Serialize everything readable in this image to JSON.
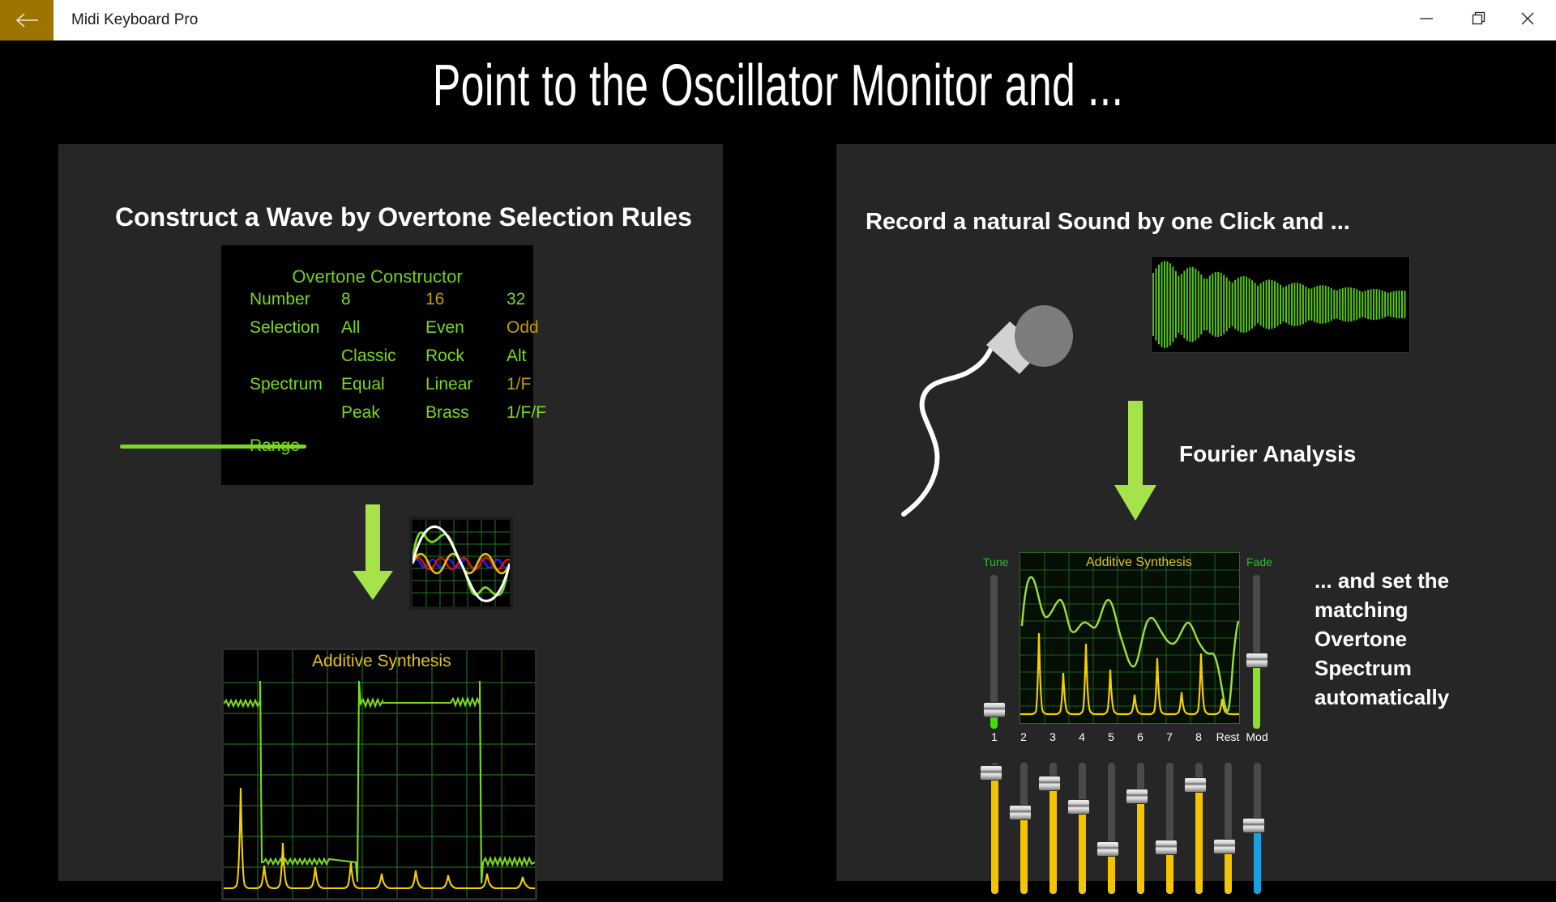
{
  "window": {
    "app_title": "Midi Keyboard Pro",
    "back_icon": "back-arrow-icon",
    "minimize_icon": "minimize-icon",
    "maximize_icon": "maximize-icon",
    "close_icon": "close-icon"
  },
  "slide": {
    "title": "Point to the Oscillator Monitor and ...",
    "left_panel_heading": "Construct a Wave by Overtone Selection Rules",
    "right_panel_heading": "Record a natural Sound by one Click and ...",
    "fourier_label": "Fourier Analysis",
    "right_note": "... and set the matching Overtone Spectrum automatically"
  },
  "overtone_constructor": {
    "title": "Overtone Constructor",
    "rows": [
      {
        "label": "Number",
        "options": [
          {
            "text": "8",
            "selected": false
          },
          {
            "text": "16",
            "selected": true
          },
          {
            "text": "32",
            "selected": false
          }
        ]
      },
      {
        "label": "Selection",
        "options": [
          {
            "text": "All",
            "selected": false
          },
          {
            "text": "Even",
            "selected": false
          },
          {
            "text": "Odd",
            "selected": true
          }
        ]
      },
      {
        "label": "",
        "options": [
          {
            "text": "Classic",
            "selected": false
          },
          {
            "text": "Rock",
            "selected": false
          },
          {
            "text": "Alt",
            "selected": false
          }
        ]
      },
      {
        "label": "Spectrum",
        "options": [
          {
            "text": "Equal",
            "selected": false
          },
          {
            "text": "Linear",
            "selected": false
          },
          {
            "text": "1/F",
            "selected": true
          }
        ]
      },
      {
        "label": "",
        "options": [
          {
            "text": "Peak",
            "selected": false
          },
          {
            "text": "Brass",
            "selected": false
          },
          {
            "text": "1/F/F",
            "selected": false
          }
        ]
      }
    ],
    "range": {
      "label": "Range",
      "value_percent": 44
    }
  },
  "left_additive_plot": {
    "title": "Additive Synthesis"
  },
  "oscillator_monitor": {
    "title": "Additive Synthesis",
    "tune": {
      "label": "Tune",
      "value_percent": 12
    },
    "fade": {
      "label": "Fade",
      "value_percent": 44
    },
    "channel_labels": [
      "1",
      "2",
      "3",
      "4",
      "5",
      "6",
      "7",
      "8",
      "Rest",
      "Mod"
    ],
    "faders": [
      {
        "name": "1",
        "value_percent": 92,
        "color": "#f5c400"
      },
      {
        "name": "2",
        "value_percent": 62,
        "color": "#f5c400"
      },
      {
        "name": "3",
        "value_percent": 84,
        "color": "#f5c400"
      },
      {
        "name": "4",
        "value_percent": 66,
        "color": "#f5c400"
      },
      {
        "name": "5",
        "value_percent": 34,
        "color": "#f5c400"
      },
      {
        "name": "6",
        "value_percent": 74,
        "color": "#f5c400"
      },
      {
        "name": "7",
        "value_percent": 35,
        "color": "#f5c400"
      },
      {
        "name": "8",
        "value_percent": 83,
        "color": "#f5c400"
      },
      {
        "name": "Rest",
        "value_percent": 36,
        "color": "#f5c400"
      },
      {
        "name": "Mod",
        "value_percent": 52,
        "color": "#1a9fe0"
      }
    ]
  },
  "colors": {
    "accent_gold": "#9e7400",
    "panel_bg": "#262626",
    "stage_bg": "#000000",
    "green": "#7ad91c",
    "selected_gold": "#c49c00",
    "arrow_green": "#a6e34a",
    "spectrum_yellow": "#f5d000",
    "mod_blue": "#1a9fe0"
  },
  "chart_data": [
    {
      "type": "line",
      "id": "recorded-waveform",
      "title": "",
      "description": "Decaying natural sound waveform captured from microphone",
      "series": [
        {
          "name": "amplitude",
          "envelope": "exponential-decay",
          "cycles": 72
        }
      ],
      "grid": false,
      "colors": [
        "#58c41a"
      ]
    },
    {
      "type": "line",
      "id": "mini-oscilloscope",
      "title": "",
      "description": "Overlaid harmonic partials and resulting composite wave",
      "series": [
        {
          "name": "composite",
          "color": "#ffffff",
          "harmonic": 1,
          "amplitude": 1.0
        },
        {
          "name": "partial-2",
          "color": "#7ad91c",
          "harmonic": 3,
          "amplitude": 0.95
        },
        {
          "name": "partial-3",
          "color": "#e8c000",
          "harmonic": 3,
          "amplitude": 0.45
        },
        {
          "name": "partial-4",
          "color": "#d81111",
          "harmonic": 5,
          "amplitude": 0.25
        },
        {
          "name": "partial-5",
          "color": "#2222ee",
          "harmonic": 7,
          "amplitude": 0.18
        }
      ],
      "grid": true
    },
    {
      "type": "line",
      "id": "left-additive-synthesis",
      "title": "Additive Synthesis",
      "description": "Square-wave time signal (green) with its odd-harmonic spectrum (yellow)",
      "series": [
        {
          "name": "waveform",
          "color": "#7ad91c",
          "shape": "square",
          "duty": 0.5
        },
        {
          "name": "spectrum",
          "color": "#f5d000",
          "peaks": [
            0.52,
            0.1,
            0.22,
            0.06,
            0.13,
            0.05,
            0.08,
            0.04,
            0.06,
            0.03
          ]
        }
      ],
      "grid": true,
      "gridcolor": "#1d6b1d"
    },
    {
      "type": "line",
      "id": "right-additive-synthesis",
      "title": "Additive Synthesis",
      "description": "Composite waveform (green) over partial spectrum peaks (yellow)",
      "series": [
        {
          "name": "waveform",
          "color": "#9ede3c",
          "values": [
            0.42,
            0.92,
            0.6,
            0.7,
            0.5,
            0.56,
            0.48,
            0.72,
            0.4,
            0.3,
            0.55,
            0.44,
            0.46,
            0.38,
            0.52,
            0.3,
            0.35,
            0.1,
            0.8
          ]
        },
        {
          "name": "spectrum",
          "color": "#f5d000",
          "peaks": [
            0.04,
            0.62,
            0.38,
            0.55,
            0.3,
            0.1,
            0.4,
            0.12,
            0.45,
            0.18,
            0.08,
            0.05,
            0.03
          ]
        }
      ],
      "xticks": [
        "1",
        "2",
        "3",
        "4",
        "5",
        "6",
        "7",
        "8",
        "Rest"
      ],
      "grid": true,
      "gridcolor": "#1d5c1d"
    }
  ]
}
